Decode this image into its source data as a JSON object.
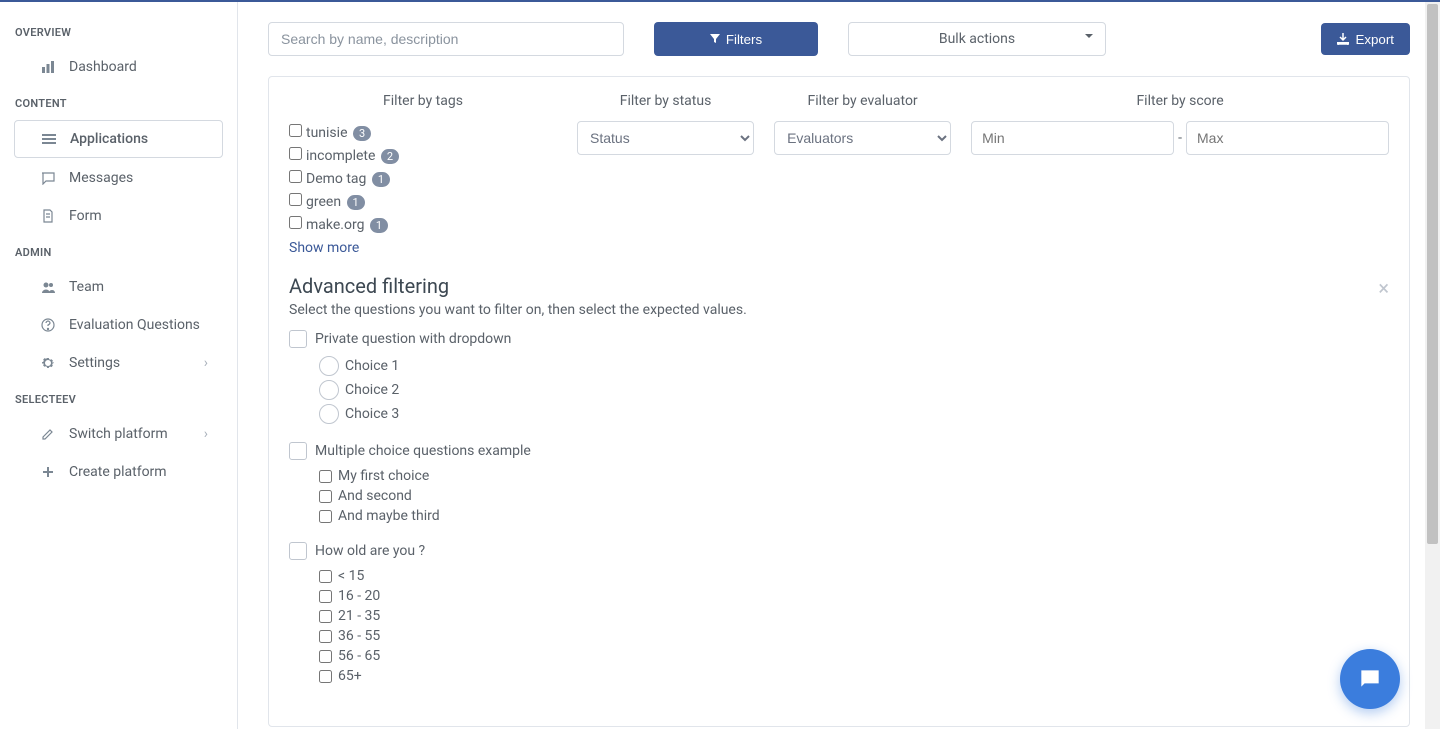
{
  "sidebar": {
    "sections": [
      {
        "title": "OVERVIEW",
        "items": [
          {
            "label": "Dashboard",
            "icon": "chart-bar",
            "name": "sidebar-item-dashboard"
          }
        ]
      },
      {
        "title": "CONTENT",
        "items": [
          {
            "label": "Applications",
            "icon": "list",
            "name": "sidebar-item-applications",
            "active": true
          },
          {
            "label": "Messages",
            "icon": "comment",
            "name": "sidebar-item-messages"
          },
          {
            "label": "Form",
            "icon": "file",
            "name": "sidebar-item-form"
          }
        ]
      },
      {
        "title": "ADMIN",
        "items": [
          {
            "label": "Team",
            "icon": "users",
            "name": "sidebar-item-team"
          },
          {
            "label": "Evaluation Questions",
            "icon": "question",
            "name": "sidebar-item-evaluation"
          },
          {
            "label": "Settings",
            "icon": "gear",
            "name": "sidebar-item-settings",
            "chevron": true
          }
        ]
      },
      {
        "title": "SELECTEEV",
        "items": [
          {
            "label": "Switch platform",
            "icon": "edit",
            "name": "sidebar-item-switch",
            "chevron": true
          },
          {
            "label": "Create platform",
            "icon": "plus",
            "name": "sidebar-item-create"
          }
        ]
      }
    ]
  },
  "toolbar": {
    "search_placeholder": "Search by name, description",
    "filters_label": "Filters",
    "bulk_label": "Bulk actions",
    "export_label": "Export"
  },
  "filters": {
    "tags_header": "Filter by tags",
    "status_header": "Filter by status",
    "evaluator_header": "Filter by evaluator",
    "score_header": "Filter by score",
    "status_placeholder": "Status",
    "evaluator_placeholder": "Evaluators",
    "min_placeholder": "Min",
    "max_placeholder": "Max",
    "score_sep": "-",
    "show_more": "Show more",
    "tags": [
      {
        "label": "tunisie",
        "count": "3"
      },
      {
        "label": "incomplete",
        "count": "2"
      },
      {
        "label": "Demo tag",
        "count": "1"
      },
      {
        "label": "green",
        "count": "1"
      },
      {
        "label": "make.org",
        "count": "1"
      }
    ]
  },
  "advanced": {
    "title": "Advanced filtering",
    "subtitle": "Select the questions you want to filter on, then select the expected values.",
    "questions": [
      {
        "label": "Private question with dropdown",
        "type": "radio",
        "options": [
          "Choice 1",
          "Choice 2",
          "Choice 3"
        ]
      },
      {
        "label": "Multiple choice questions example",
        "type": "checkbox",
        "options": [
          "My first choice",
          "And second",
          "And maybe third"
        ]
      },
      {
        "label": "How old are you ?",
        "type": "checkbox",
        "options": [
          "< 15",
          "16 - 20",
          "21 - 35",
          "36 - 55",
          "56 - 65",
          "65+"
        ]
      }
    ]
  }
}
